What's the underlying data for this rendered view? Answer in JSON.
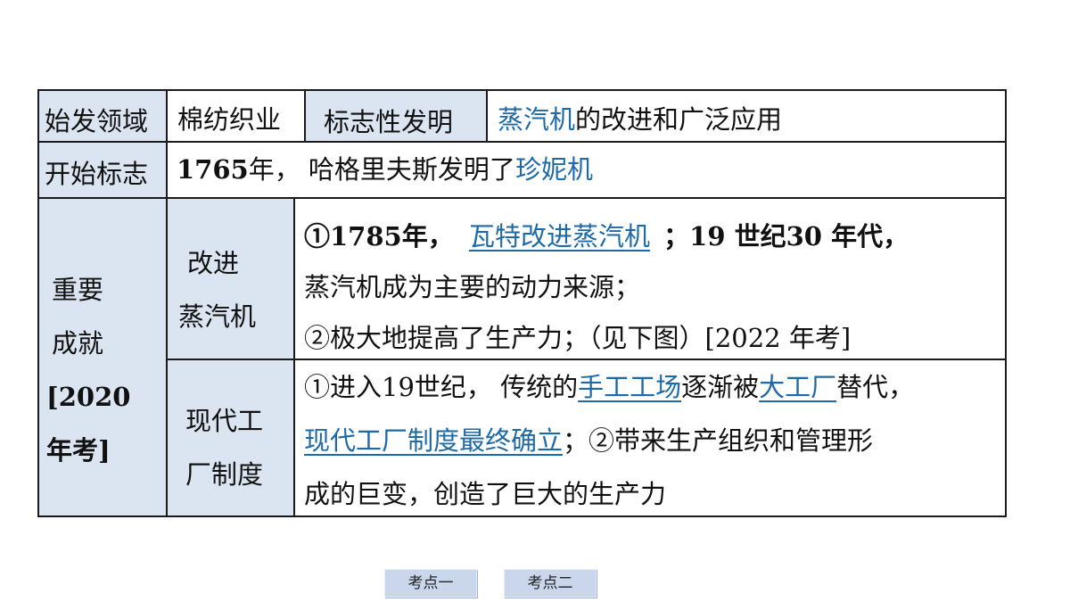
{
  "table": {
    "row1": {
      "label": "始发领域",
      "domain": "棉纺织业",
      "invention_label": "标志性发明",
      "invention_hl": "蒸汽机",
      "invention_rest": "的改进和广泛应用"
    },
    "row2": {
      "label": "开始标志",
      "year": "1765",
      "text": "年， 哈格里夫斯发明了",
      "hl": "珍妮机"
    },
    "achievements": {
      "label_l1": "重要",
      "label_l2": "成就",
      "label_l3": "[2020",
      "label_l4": "年考]",
      "steam": {
        "label_l1": "改进",
        "label_l2": "蒸汽机",
        "p1_a": "①1785年，",
        "p1_u": "瓦特改进蒸汽机",
        "p1_b": "；19 世纪30 年代，",
        "p2": "蒸汽机成为主要的动力来源；",
        "p3": "②极大地提高了生产力；（见下图）[2022 年考]"
      },
      "factory": {
        "label_l1": "现代工",
        "label_l2": "厂制度",
        "p1_a": "①进入19世纪， 传统的",
        "p1_u1": "手工工场",
        "p1_b": "逐渐被",
        "p1_u2": "大工厂",
        "p1_c": "替代，",
        "p2_u": "现代工厂制度最终确立",
        "p2_b": "；②带来生产组织和管理形",
        "p3": "成的巨变，创造了巨大的生产力"
      }
    }
  },
  "nav": {
    "btn1": "考点一",
    "btn2": "考点二"
  },
  "colors": {
    "header_bg": "#dbe5f1",
    "highlight": "#1f6aa6",
    "border": "#1a1a1a",
    "nav_bg": "#c9d6ec"
  }
}
